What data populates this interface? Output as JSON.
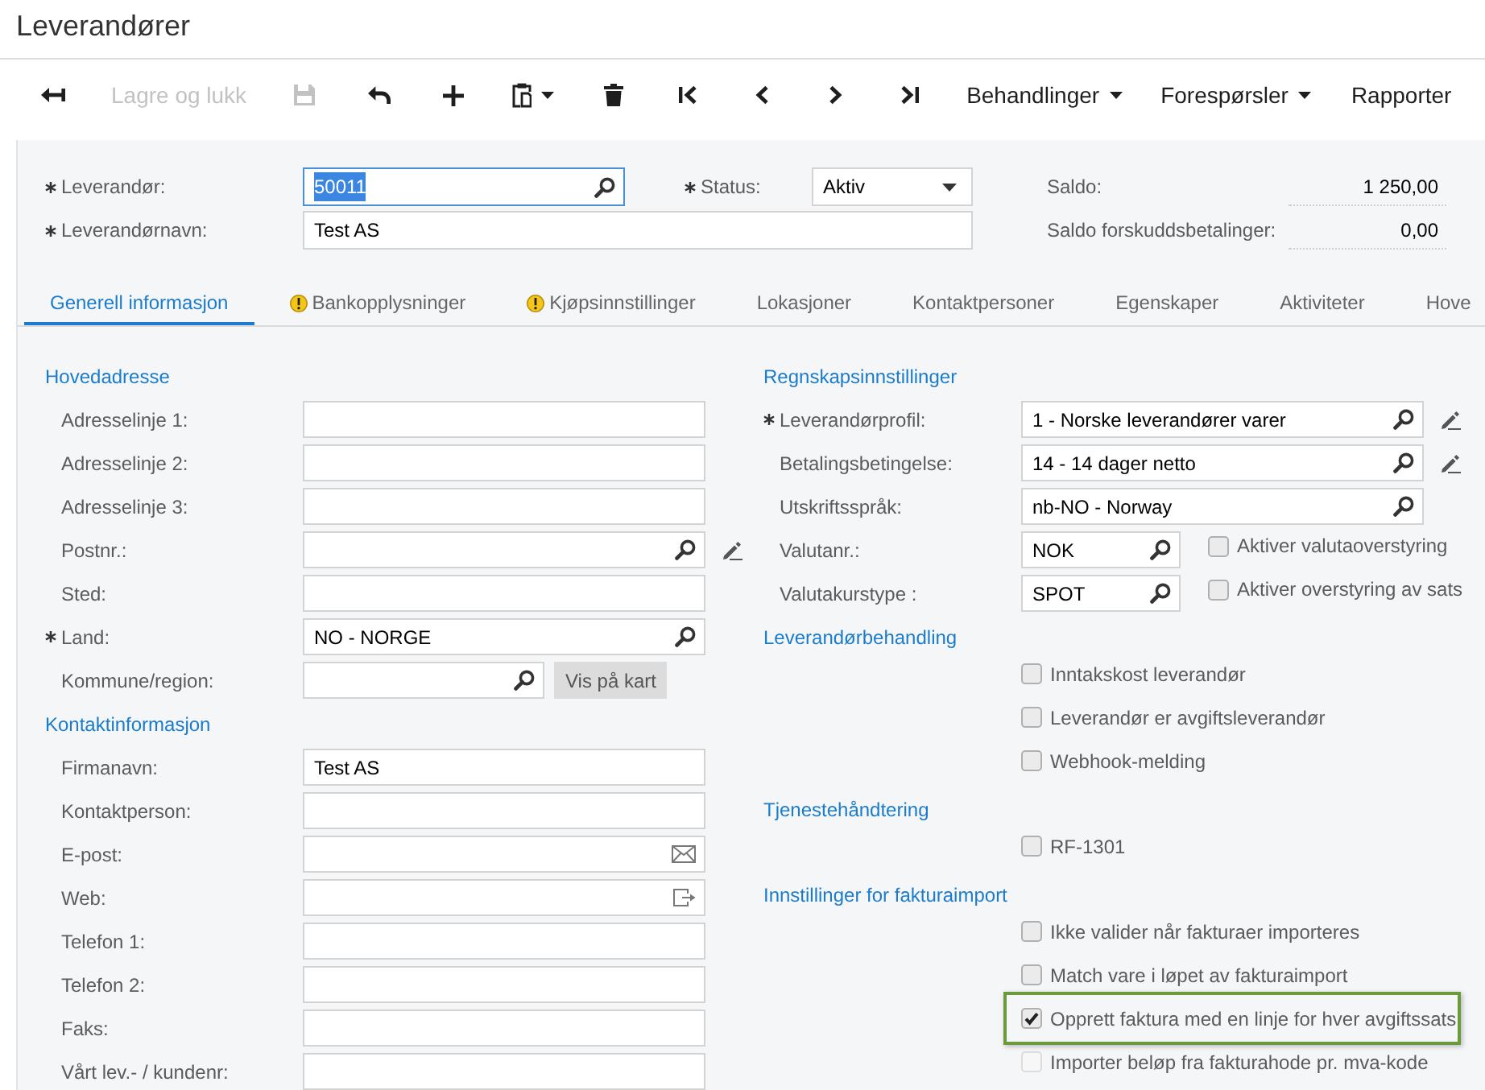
{
  "window": {
    "title": "Leverandører"
  },
  "toolbar": [
    {
      "kind": "icon",
      "disabled": false
    },
    {
      "kind": "text",
      "label": "Lagre og lukk",
      "disabled": true
    },
    {
      "kind": "icon",
      "disabled": true
    },
    {
      "kind": "icon",
      "disabled": false
    },
    {
      "kind": "icon",
      "disabled": false
    },
    {
      "kind": "icon-menu",
      "disabled": false
    },
    {
      "kind": "icon",
      "disabled": false
    },
    {
      "kind": "icon",
      "disabled": false
    },
    {
      "kind": "icon",
      "disabled": false
    },
    {
      "kind": "icon",
      "disabled": false
    },
    {
      "kind": "icon",
      "disabled": false
    },
    {
      "kind": "menu",
      "label": "Behandlinger",
      "disabled": false
    },
    {
      "kind": "menu",
      "label": "Forespørsler",
      "disabled": false
    },
    {
      "kind": "text",
      "label": "Rapporter",
      "disabled": false
    }
  ],
  "header": {
    "rows": [
      {
        "fields": [
          {
            "kind": "lookup",
            "label": "Leverandør:",
            "required": true,
            "value": "50011",
            "focused": true
          },
          {
            "kind": "select",
            "label": "Status:",
            "required": true,
            "value": "Aktiv",
            "focused": false
          }
        ]
      },
      {
        "fields": [
          {
            "kind": "text",
            "label": "Leverandørnavn:",
            "required": true,
            "value": "Test AS",
            "focused": false
          }
        ]
      }
    ],
    "balances": [
      {
        "label": "Saldo:",
        "value": "1 250,00"
      },
      {
        "label": "Saldo forskuddsbetalinger:",
        "value": "0,00"
      }
    ]
  },
  "tabs": [
    {
      "label": "Generell informasjon",
      "selected": true,
      "warning": false
    },
    {
      "label": "Bankopplysninger",
      "selected": false,
      "warning": true
    },
    {
      "label": "Kjøpsinnstillinger",
      "selected": false,
      "warning": true
    },
    {
      "label": "Lokasjoner",
      "selected": false,
      "warning": false
    },
    {
      "label": "Kontaktpersoner",
      "selected": false,
      "warning": false
    },
    {
      "label": "Egenskaper",
      "selected": false,
      "warning": false
    },
    {
      "label": "Aktiviteter",
      "selected": false,
      "warning": false
    },
    {
      "label": "Hove",
      "selected": false,
      "warning": false
    }
  ],
  "columns": [
    {
      "sections": [
        {
          "kind": "fields",
          "title": "Hovedadresse",
          "fields": [
            {
              "kind": "text",
              "label": "Adresselinje 1:",
              "required": false
            },
            {
              "kind": "text",
              "label": "Adresselinje 2:",
              "required": false
            },
            {
              "kind": "text",
              "label": "Adresselinje 3:",
              "required": false
            },
            {
              "kind": "lookup-edit",
              "label": "Postnr.:",
              "required": false
            },
            {
              "kind": "text",
              "label": "Sted:",
              "required": false
            },
            {
              "kind": "lookup",
              "label": "Land:",
              "required": true,
              "value": "NO - NORGE"
            },
            {
              "kind": "lookup-map",
              "label": "Kommune/region:",
              "required": false,
              "button": "Vis på kart"
            }
          ]
        },
        {
          "kind": "fields",
          "title": "Kontaktinformasjon",
          "fields": [
            {
              "kind": "text",
              "label": "Firmanavn:",
              "required": false,
              "value": "Test AS"
            },
            {
              "kind": "text",
              "label": "Kontaktperson:",
              "required": false
            },
            {
              "kind": "email",
              "label": "E-post:",
              "required": false
            },
            {
              "kind": "web",
              "label": "Web:",
              "required": false
            },
            {
              "kind": "text",
              "label": "Telefon 1:",
              "required": false
            },
            {
              "kind": "text",
              "label": "Telefon 2:",
              "required": false
            },
            {
              "kind": "text",
              "label": "Faks:",
              "required": false
            },
            {
              "kind": "text",
              "label": "Vårt lev.- / kundenr:",
              "required": false
            }
          ]
        }
      ]
    },
    {
      "sections": [
        {
          "kind": "fields",
          "title": "Regnskapsinnstillinger",
          "fields": [
            {
              "kind": "lookup-edit",
              "label": "Leverandørprofil:",
              "required": true,
              "value": "1 - Norske leverandører varer"
            },
            {
              "kind": "lookup-edit",
              "label": "Betalingsbetingelse:",
              "required": false,
              "value": "14 - 14 dager netto"
            },
            {
              "kind": "lookup",
              "label": "Utskriftsspråk:",
              "required": false,
              "value": "nb-NO - Norway"
            },
            {
              "kind": "lookup-check",
              "label": "Valutanr.:",
              "required": false,
              "value": "NOK",
              "checkbox": {
                "label": "Aktiver valutaoverstyring",
                "checked": false
              }
            },
            {
              "kind": "lookup-check",
              "label": "Valutakurstype :",
              "required": false,
              "value": "SPOT",
              "checkbox": {
                "label": "Aktiver overstyring av sats",
                "checked": false
              }
            }
          ]
        },
        {
          "kind": "options",
          "title": "Leverandørbehandling",
          "options": [
            {
              "label": "Inntakskost leverandør",
              "checked": false,
              "disabled": false,
              "highlighted": false
            },
            {
              "label": "Leverandør er avgiftsleverandør",
              "checked": false,
              "disabled": false,
              "highlighted": false
            },
            {
              "label": "Webhook-melding",
              "checked": false,
              "disabled": false,
              "highlighted": false
            }
          ]
        },
        {
          "kind": "options",
          "title": "Tjenestehåndtering",
          "options": [
            {
              "label": "RF-1301",
              "checked": false,
              "disabled": false,
              "highlighted": false
            }
          ]
        },
        {
          "kind": "options",
          "title": "Innstillinger for fakturaimport",
          "options": [
            {
              "label": "Ikke valider når fakturaer importeres",
              "checked": false,
              "disabled": false,
              "highlighted": false
            },
            {
              "label": "Match vare i løpet av fakturaimport",
              "checked": false,
              "disabled": false,
              "highlighted": false
            },
            {
              "label": "Opprett faktura med en linje for hver avgiftssats",
              "checked": true,
              "disabled": false,
              "highlighted": true
            },
            {
              "label": "Importer beløp fra fakturahode pr. mva-kode",
              "checked": false,
              "disabled": true,
              "highlighted": false
            }
          ]
        }
      ]
    }
  ]
}
